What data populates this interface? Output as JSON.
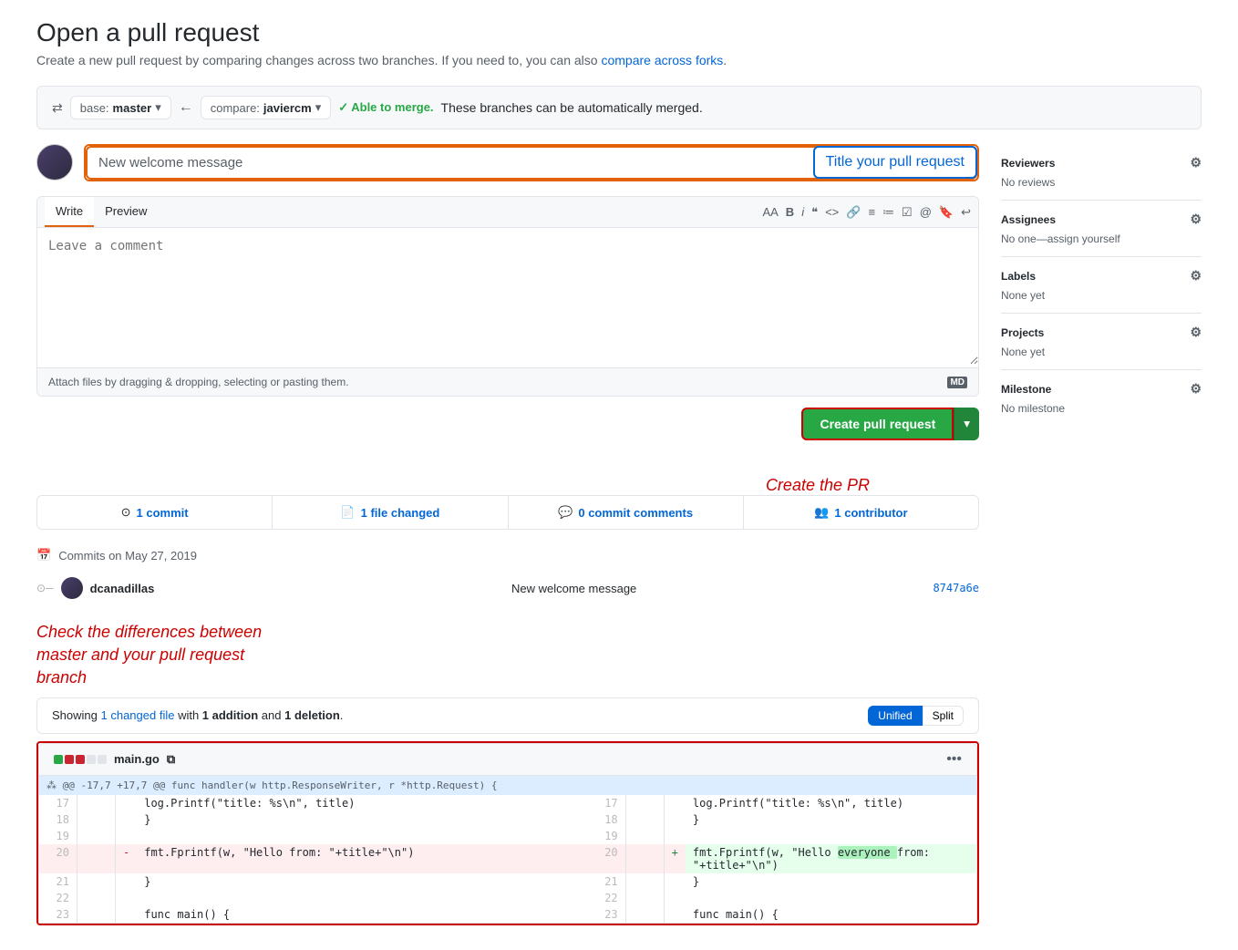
{
  "page": {
    "title": "Open a pull request",
    "subtitle": "Create a new pull request by comparing changes across two branches. If you need to, you can also",
    "subtitle_link": "compare across forks",
    "subtitle_end": "."
  },
  "branch_bar": {
    "base_label": "base:",
    "base_branch": "master",
    "compare_label": "compare:",
    "compare_branch": "javiercm",
    "merge_status": "✓ Able to merge.",
    "merge_message": "These branches can be automatically merged."
  },
  "form": {
    "title_value": "New welcome message",
    "title_placeholder": "Title your pull request",
    "comment_placeholder": "Leave a comment",
    "attach_text": "Attach files by dragging & dropping, selecting or pasting them.",
    "write_tab": "Write",
    "preview_tab": "Preview",
    "create_button": "Create pull request"
  },
  "sidebar": {
    "reviewers_label": "Reviewers",
    "reviewers_value": "No reviews",
    "assignees_label": "Assignees",
    "assignees_value": "No one—assign yourself",
    "labels_label": "Labels",
    "labels_value": "None yet",
    "projects_label": "Projects",
    "projects_value": "None yet",
    "milestone_label": "Milestone",
    "milestone_value": "No milestone"
  },
  "stats": {
    "commits": "1 commit",
    "files_changed": "1 file changed",
    "comments": "0 commit comments",
    "contributors": "1 contributor"
  },
  "commits_section": {
    "date_label": "Commits on May 27, 2019",
    "author": "dcanadillas",
    "message": "New welcome message",
    "sha": "8747a6e"
  },
  "diff": {
    "showing_text": "Showing",
    "changed_file_count": "1 changed file",
    "addition_count": "1 addition",
    "deletion_count": "1 deletion",
    "filename": "main.go",
    "unified_btn": "Unified",
    "split_btn": "Split",
    "hunk_header": "@@ -17,7 +17,7 @@ func handler(w http.ResponseWriter, r *http.Request) {",
    "lines": [
      {
        "left_num": "17",
        "right_num": "17",
        "type": "normal",
        "content": "            log.Printf(\"title: %s\\n\", title)"
      },
      {
        "left_num": "18",
        "right_num": "18",
        "type": "normal",
        "content": "        }"
      },
      {
        "left_num": "19",
        "right_num": "19",
        "type": "normal",
        "content": ""
      },
      {
        "left_num": "20",
        "right_num": "",
        "type": "del",
        "mark": "-",
        "content": "        fmt.Fprintf(w, \"Hello from: \"+title+\"\\n\")"
      },
      {
        "left_num": "",
        "right_num": "20",
        "type": "add",
        "mark": "+",
        "content": "        fmt.Fprintf(w, \"Hello everyone from: \"+title+\"\\n\")"
      },
      {
        "left_num": "21",
        "right_num": "21",
        "type": "normal",
        "content": "    }"
      },
      {
        "left_num": "22",
        "right_num": "22",
        "type": "normal",
        "content": ""
      },
      {
        "left_num": "23",
        "right_num": "23",
        "type": "normal",
        "content": "    func main() {"
      }
    ]
  },
  "annotations": {
    "title_arrow": "Title your pull request",
    "create_pr": "Create the PR",
    "check_diff": "Check the differences between\nmaster and your pull request\nbranch"
  }
}
